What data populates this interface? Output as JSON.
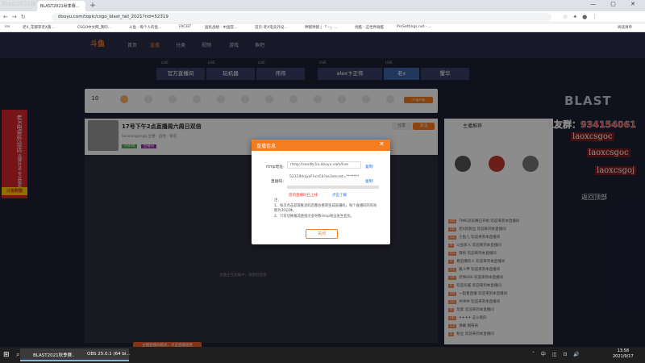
{
  "browser": {
    "overlay_title": "Blast2021秋季赛",
    "tab_title": "BLAST2021秋季赛...",
    "window_controls": "— ▢ ✕",
    "url": "douyu.com/topic/csgo_blast_fall_2021?rid=52319",
    "bookmarks": [
      "ins",
      "老X_花都李老X菌...",
      "CSGO中文网_我的...",
      "斗鱼 - 每个人的直...",
      "FACEIT",
      "国民战绩 - 中国官...",
      "首页-老X电竞外设...",
      "神猪神猪 | 「-·-」...",
      "优酷 - 这世界很酷",
      "ProSettings.net - ..."
    ],
    "reading_list": "阅读清单"
  },
  "site": {
    "logo": "斗鱼",
    "nav": [
      "首页",
      "直播",
      "分类",
      "视频",
      "游戏",
      "鱼吧"
    ],
    "live_label": "LIVE",
    "room_tabs": [
      "官方直播间",
      "玩机器",
      "伟伟",
      "alex卞正伟",
      "老x",
      "蟹华"
    ],
    "gift_count": "10",
    "pc_badge": "PC客户端",
    "room_title": "17号下午2点直播周六周日双倍",
    "room_meta": "lacsexugongg  主播  · 战地 · 排名",
    "room_tag1": "VSPIN",
    "room_tag2": "直播间",
    "share": "分享",
    "follow": "关注",
    "player_hint": "主播正在加载中，请稍后连接",
    "player_bottom": "主播直播间模式，点击直播观看",
    "side_title": "主播推荐",
    "back_to_top": "返回顶部",
    "blast_logo": "BLAST",
    "chat": [
      "  TIME冠军赛已开始  欢迎来到本直播间",
      "  老X的粉丝  欢迎来到本直播间",
      "  小鱼儿  欢迎来到本直播间",
      "  斗鱼新人  欢迎来到本直播间",
      "  铁粉  欢迎来到本直播间",
      "  看直播的人  欢迎来到本直播间",
      "  路人甲  欢迎来到本直播间",
      "  老铁666  欢迎来到本直播间",
      "  欢迎光临  欢迎来到本直播间",
      "  一起看直播  欢迎来到本直播间",
      "  冲冲冲  欢迎来到本直播间",
      "  玩家  欢迎来到本直播间",
      "  ✦✦✦✦  这么粗的",
      "  弹幕  钢铁侠",
      "  粉丝  欢迎来到本直播间"
    ]
  },
  "overlay": {
    "qq_group": "水友群：934154061",
    "ids": [
      "laoxcsgoc",
      "laoxcsgoc",
      "laoxcsgoj"
    ],
    "promo_text": "老X电竞外设店",
    "promo_sub": "品牌外设 专业配机",
    "promo_btn": "斗鱼购物"
  },
  "modal": {
    "title": "直播信息",
    "rtmp_label": "rtmp地址:",
    "rtmp_value": "rtmp://sendtc1a.douyu.com/live",
    "key_label": "直播码:",
    "key_value": "52319rkLyoFhcsCb?as3secret=*******",
    "copy": "复制",
    "warning": "您的直播码已上线",
    "learn_more": "点击了解",
    "notes_label": "注：",
    "note1": "1、每次点击获取推流码后都会重新生成直播码，每个直播码的有效期为30分钟。",
    "note2": "2、只有切换推流链接才会导致rtmp地址发生变化。",
    "close_btn": "关闭"
  },
  "taskbar": {
    "start_icon": "⊞",
    "task1": "BLAST2021秋季赛...",
    "task2": "OBS 25.0.1 (64 bi...",
    "tray": "ˆ 中 ◫ ⊡ 🔊",
    "time": "13:58",
    "date": "2021/9/17"
  }
}
